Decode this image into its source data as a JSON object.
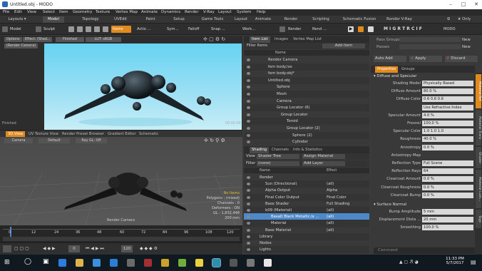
{
  "window": {
    "title": "Untitled.obj - MODO"
  },
  "menu": [
    "File",
    "Edit",
    "View",
    "Select",
    "Item",
    "Geometry",
    "Texture",
    "Vertex Map",
    "Animate",
    "Dynamics",
    "Render",
    "V-Ray",
    "Layout",
    "System",
    "Help"
  ],
  "layout_tabs": {
    "left": "Layouts",
    "tabs": [
      "Model",
      "Topology",
      "UVEdit",
      "Paint",
      "Setup",
      "Game Tools",
      "Layout",
      "Animate",
      "Render",
      "Scripting",
      "Schematic Fusion",
      "Render V-Ray"
    ],
    "right": "Only"
  },
  "toolbar": {
    "model": "Model",
    "sculpt": "Sculpt",
    "items": "Items",
    "action_center": "Actio ...",
    "symmetry": "Sym...",
    "falloff": "Falloff",
    "snap": "Snap ...",
    "work": "Work...",
    "render": "Render",
    "rend": "Rend ...",
    "logo": "MODO"
  },
  "viewport_top": {
    "options": "Options",
    "effect": "Effect: (Shad...",
    "finished": "Finished",
    "lut": "LUT: sRGB",
    "render_camera": "(Render Camera)",
    "shading": "Shading: Full",
    "status": "Finished",
    "time": "00:00:00"
  },
  "viewport_tabs": [
    "3D View",
    "UV Texture View",
    "Render Preset Browser",
    "Gradient Editor",
    "Schematic"
  ],
  "viewport_3d": {
    "camera": "Camera",
    "default": "Default",
    "ray_gl": "Ray GL: Off",
    "info": [
      "No Items",
      "Polygons : (mixed)",
      "Channels : 0",
      "Deformers : ON",
      "GL : 1,832,448",
      "200 mm"
    ],
    "label": "Render Camera"
  },
  "timeline": {
    "ticks": [
      "0",
      "12",
      "24",
      "36",
      "48",
      "60",
      "72",
      "84",
      "96",
      "108",
      "120"
    ],
    "start": "0",
    "end": "120"
  },
  "item_list": {
    "tabs": [
      "Item List",
      "Images",
      "Vertex Map List"
    ],
    "filter": "Filter Items",
    "add": "Add Item",
    "col_name": "Name",
    "rows": [
      {
        "label": "Render Camera",
        "indent": 34
      },
      {
        "label": "fem body.lxo",
        "indent": 34
      },
      {
        "label": "fem body.obj*",
        "indent": 34
      },
      {
        "label": "Untitled.obj",
        "indent": 34
      },
      {
        "label": "Sphere",
        "indent": 46
      },
      {
        "label": "Mesh",
        "indent": 46
      },
      {
        "label": "Camera",
        "indent": 46
      },
      {
        "label": "Group Locator (6)",
        "indent": 46
      },
      {
        "label": "Group Locator",
        "indent": 52
      },
      {
        "label": "Toroid",
        "indent": 60
      },
      {
        "label": "Group Locator (2)",
        "indent": 60
      },
      {
        "label": "Sphere (2)",
        "indent": 68
      },
      {
        "label": "Cylinder",
        "indent": 68
      }
    ]
  },
  "shader_tree": {
    "tabs": [
      "Shading",
      "Channels",
      "Info & Statistics"
    ],
    "view_label": "View",
    "view": "Shader Tree",
    "assign": "Assign Material",
    "filter_label": "Filter",
    "filter": "(none)",
    "add": "Add Layer",
    "col_name": "Name",
    "col_effect": "Effect",
    "rows": [
      {
        "name": "Render",
        "effect": ""
      },
      {
        "name": "Sun (Directional)",
        "effect": "(all)"
      },
      {
        "name": "Alpha Output",
        "effect": "Alpha"
      },
      {
        "name": "Final Color Output",
        "effect": "Final Color"
      },
      {
        "name": "Base Shader",
        "effect": "Full Shading"
      },
      {
        "name": "b09 (Material)",
        "effect": "(all)"
      },
      {
        "name": "Basalt Black Metallic.lx ...",
        "effect": "(all)"
      },
      {
        "name": "Material",
        "effect": "(all)"
      },
      {
        "name": "Base Material",
        "effect": "(all)"
      },
      {
        "name": "Library",
        "effect": ""
      },
      {
        "name": "Nodes",
        "effect": ""
      },
      {
        "name": "Lights",
        "effect": ""
      }
    ]
  },
  "right_panel": {
    "pass_groups": "Pass Groups",
    "passes": "Passes",
    "new": "New",
    "new2": "New",
    "auto_add": "Auto Add",
    "apply": "Apply",
    "discard": "Discard",
    "tabs": [
      "Properties",
      "Groups"
    ],
    "section": "Diffuse and Specular",
    "rows": [
      {
        "label": "Shading Model",
        "value": "Physically Based"
      },
      {
        "label": "Diffuse Amount",
        "value": "80.0 %"
      },
      {
        "label": "Diffuse Color",
        "value": "0.6   0.6   0.6"
      },
      {
        "label": "",
        "value": "Use Refractive Index"
      },
      {
        "label": "Specular Amount",
        "value": "4.0 %"
      },
      {
        "label": "Fresnel",
        "value": "100.0 %"
      },
      {
        "label": "Specular Color",
        "value": "1.0   1.0   1.0"
      },
      {
        "label": "Roughness",
        "value": "40.0 %"
      },
      {
        "label": "Anisotropy",
        "value": "0.0 %"
      },
      {
        "label": "Anisotropy Map",
        "value": ""
      },
      {
        "label": "Reflection Type",
        "value": "Full Scene"
      },
      {
        "label": "Reflection Rays",
        "value": "64"
      },
      {
        "label": "Clearcoat Amount",
        "value": "0.0 %"
      },
      {
        "label": "Clearcoat Roughness",
        "value": "0.0 %"
      },
      {
        "label": "Clearcoat Bump",
        "value": "0.0 %"
      }
    ],
    "section2": "Surface Normal",
    "rows2": [
      {
        "label": "Bump Amplitude",
        "value": "5 mm"
      },
      {
        "label": "Displacement Dista ...",
        "value": "20 mm"
      },
      {
        "label": "Smoothing",
        "value": "100.0 %"
      }
    ],
    "side_tabs": [
      "Material Ref",
      "Material Trans",
      "Shader",
      "Material Lum...",
      "Tags"
    ],
    "command": "Command"
  },
  "taskbar": {
    "time": "11:33 PM",
    "date": "5/7/2017"
  }
}
